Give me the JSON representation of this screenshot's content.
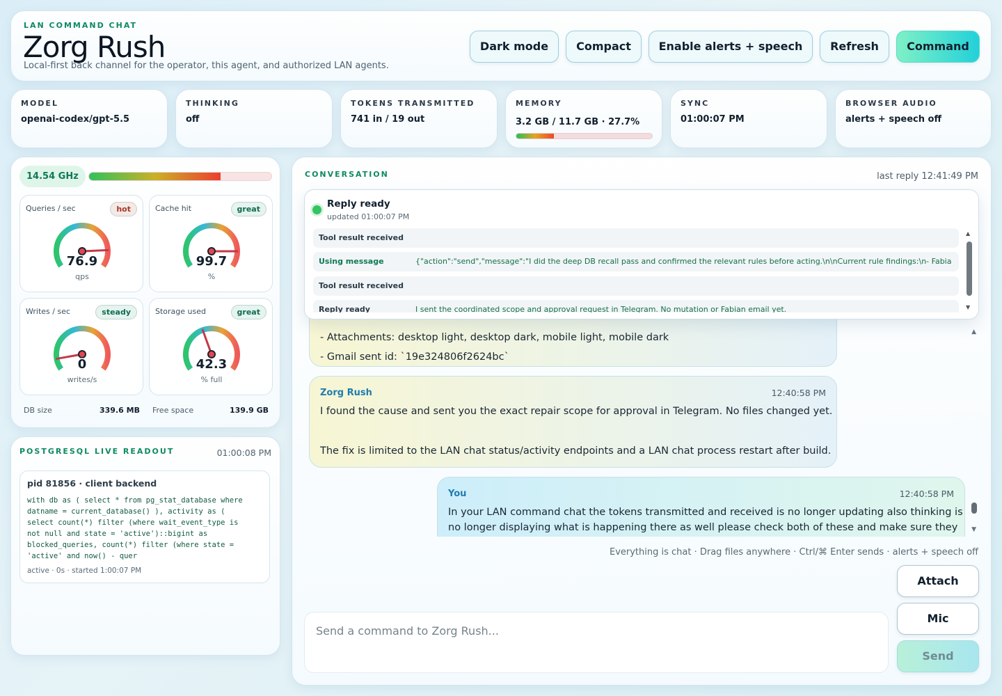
{
  "header": {
    "eyebrow": "LAN COMMAND CHAT",
    "title": "Zorg Rush",
    "subtitle": "Local-first back channel for the operator, this agent, and authorized LAN agents.",
    "buttons": {
      "dark_mode": "Dark mode",
      "compact": "Compact",
      "alerts": "Enable alerts + speech",
      "refresh": "Refresh",
      "command": "Command"
    }
  },
  "stats": {
    "model": {
      "label": "MODEL",
      "value": "openai-codex/gpt-5.5"
    },
    "thinking": {
      "label": "THINKING",
      "value": "off"
    },
    "tokens": {
      "label": "TOKENS TRANSMITTED",
      "value": "741 in / 19 out"
    },
    "memory": {
      "label": "MEMORY",
      "value": "3.2 GB / 11.7 GB · 27.7%",
      "percent": 27.7
    },
    "sync": {
      "label": "SYNC",
      "value": "01:00:07 PM"
    },
    "audio": {
      "label": "BROWSER AUDIO",
      "value": "alerts + speech off"
    }
  },
  "cpu": {
    "frequency": "14.54 GHz",
    "load_percent": 72
  },
  "gauges": [
    {
      "name": "Queries / sec",
      "badge": "hot",
      "value": "76.9",
      "unit": "qps",
      "needle_fraction": 0.85
    },
    {
      "name": "Cache hit",
      "badge": "great",
      "value": "99.7",
      "unit": "%",
      "needle_fraction": 0.86
    },
    {
      "name": "Writes / sec",
      "badge": "steady",
      "value": "0",
      "unit": "writes/s",
      "needle_fraction": 0.1
    },
    {
      "name": "Storage used",
      "badge": "great",
      "value": "42.3",
      "unit": "% full",
      "needle_fraction": 0.42
    }
  ],
  "db": {
    "size_label": "DB size",
    "size_value": "339.6 MB",
    "free_label": "Free space",
    "free_value": "139.9 GB"
  },
  "postgres": {
    "title": "POSTGRESQL LIVE READOUT",
    "time": "01:00:08 PM",
    "pid": "pid 81856 · client backend",
    "sql": "with db as ( select * from pg_stat_database where\ndatname = current_database() ), activity as (\nselect count(*) filter (where wait_event_type is\nnot null and state = 'active')::bigint as\nblocked_queries, count(*) filter (where state =\n'active' and now() - quer",
    "meta": "active · 0s · started 1:00:07 PM"
  },
  "conversation": {
    "label": "CONVERSATION",
    "last_reply": "last reply 12:41:49 PM",
    "status": {
      "title": "Reply ready",
      "updated": "updated 01:00:07 PM",
      "items": [
        {
          "kind": "Tool result received",
          "detail": ""
        },
        {
          "kind": "Using message",
          "detail": "{\"action\":\"send\",\"message\":\"I did the deep DB recall pass and confirmed the relevant rules before acting.\\n\\nCurrent rule findings:\\n- Fabia"
        },
        {
          "kind": "Tool result received",
          "detail": ""
        },
        {
          "kind": "Reply ready",
          "detail": "I sent the coordinated scope and approval request in Telegram. No mutation or Fabian email yet."
        }
      ]
    },
    "messages": [
      {
        "lines": [
          "- Attachments: desktop light, desktop dark, mobile light, mobile dark",
          "- Gmail sent id: `19e324806f2624bc`"
        ]
      },
      {
        "author": "Zorg Rush",
        "time": "12:40:58 PM",
        "lines": [
          "I found the cause and sent you the exact repair scope for approval in Telegram. No files changed yet.",
          "The fix is limited to the LAN chat status/activity endpoints and a LAN chat process restart after build."
        ]
      },
      {
        "author": "You",
        "time": "12:40:58 PM",
        "lines": [
          "In your LAN command chat the tokens transmitted and received is no longer updating also thinking is",
          "no longer displaying what is happening there as well please check both of these and make sure they"
        ]
      }
    ],
    "hint": "Everything is chat · Drag files anywhere · Ctrl/⌘ Enter sends · alerts + speech off",
    "input_placeholder": "Send a command to Zorg Rush...",
    "buttons": {
      "attach": "Attach",
      "mic": "Mic",
      "send": "Send"
    }
  }
}
